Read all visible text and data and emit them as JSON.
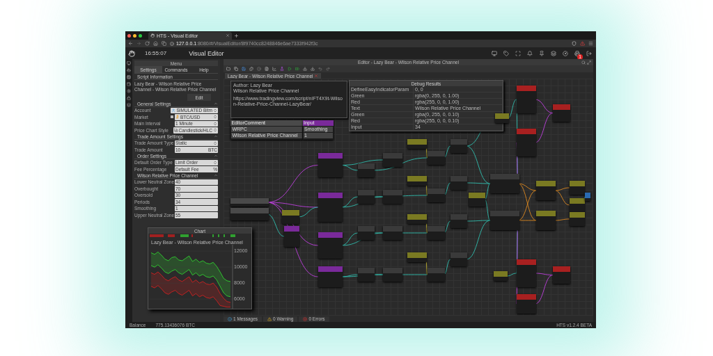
{
  "browser": {
    "tab_title": "HTS - Visual Editor",
    "url_host": "127.0.0.1",
    "url_path": ":8080/#/VisualEditor/8f9740cc8248846e6ae7333f942f3c"
  },
  "header": {
    "time": "16:55:07",
    "title": "Visual Editor",
    "badge": "1"
  },
  "menu": {
    "title": "Menu",
    "tabs": [
      {
        "label": "Settings",
        "selected": true
      },
      {
        "label": "Commands",
        "selected": false
      },
      {
        "label": "Help",
        "selected": false
      }
    ],
    "script_info": {
      "title": "Script Information",
      "text": "Lazy Bear - Wilson Relative Price Channel - Wilson Relative Price Channel",
      "button": "Edit"
    },
    "sections": [
      {
        "title": "General Settings",
        "fields": [
          {
            "label": "Account",
            "value": "SIMULATED Bitm",
            "kind": "account-select"
          },
          {
            "label": "Market",
            "value": "BTC/USD",
            "kind": "market-select"
          },
          {
            "label": "Main Interval",
            "value": "1 Minute",
            "kind": "select"
          },
          {
            "label": "Price Chart Style",
            "value": "Candlestick/HLC",
            "kind": "style-select"
          }
        ]
      },
      {
        "title": "Trade Amount Settings",
        "fields": [
          {
            "label": "Trade Amount Type",
            "value": "Static",
            "kind": "select"
          },
          {
            "label": "Trade Amount",
            "value": "10",
            "unit": "BTC",
            "kind": "unit-input"
          }
        ]
      },
      {
        "title": "Order Settings",
        "fields": [
          {
            "label": "Default Order Type",
            "value": "Limit Order",
            "kind": "select"
          },
          {
            "label": "Fee Percentage",
            "value": "Default Fee",
            "unit": "%",
            "kind": "unit-input"
          }
        ]
      },
      {
        "title": "Wilson Relative Price Channel",
        "fields": [
          {
            "label": "Lower Neutral Zone",
            "value": "40",
            "kind": "input"
          },
          {
            "label": "Overbought",
            "value": "70",
            "kind": "input"
          },
          {
            "label": "Oversold",
            "value": "30",
            "kind": "input"
          },
          {
            "label": "Periods",
            "value": "34",
            "kind": "input"
          },
          {
            "label": "Smoothing",
            "value": "1",
            "kind": "input"
          },
          {
            "label": "Upper Neutral Zone",
            "value": "55",
            "kind": "input"
          }
        ]
      }
    ]
  },
  "editor": {
    "title": "Editor - Lazy Bear - Wilson Relative Price Channel",
    "doc_tab": "Lazy Bear - Wilson Relative Price Channel",
    "comment": [
      "Author: Lazy Bear",
      "Wilson Relative Price Channel",
      "https://www.tradingview.com/script/nIFT4X9t-Wilson-Relative-Price-Channel-LazyBear/"
    ],
    "debug": {
      "title": "Debug Results",
      "rows": [
        {
          "name": "DefineEasyIndicatorParam",
          "value": "0, 0"
        },
        {
          "name": "Green",
          "value": "rgba(0, 255, 0, 1.00)"
        },
        {
          "name": "Red",
          "value": "rgba(255, 0, 0, 1.00)"
        },
        {
          "name": "Text",
          "value": "Wilson Relative Price Channel"
        },
        {
          "name": "Green",
          "value": "rgba(0, 255, 0, 0.10)"
        },
        {
          "name": "Red",
          "value": "rgba(255, 0, 0, 0.10)"
        },
        {
          "name": "Input",
          "value": "34"
        }
      ]
    },
    "nodes": [
      {
        "color": "#4a4a4a",
        "title": "EditorComment",
        "lines": [
          "WRPC",
          "Wilson Relative Price Channel"
        ]
      },
      {
        "color": "#7a2a9a",
        "title": "Input",
        "lines": [
          "Smoothing",
          "1"
        ]
      },
      {
        "color": "#4a4a4a"
      },
      {
        "color": "#4a4a4a"
      },
      {
        "color": "#7a7a22"
      },
      {
        "color": "#7a2a9a"
      },
      {
        "color": "#7a2a9a"
      },
      {
        "color": "#7a2a9a"
      },
      {
        "color": "#7a2a9a"
      },
      {
        "color": "#7a2a9a"
      },
      {
        "color": "#3a3a3a"
      },
      {
        "color": "#3a3a3a"
      },
      {
        "color": "#3a3a3a"
      },
      {
        "color": "#3a3a3a"
      },
      {
        "color": "#3a3a3a"
      },
      {
        "color": "#3a3a3a"
      },
      {
        "color": "#3a3a3a"
      },
      {
        "color": "#3a3a3a"
      },
      {
        "color": "#7a7a22"
      },
      {
        "color": "#7a7a22"
      },
      {
        "color": "#7a7a22"
      },
      {
        "color": "#7a7a22"
      },
      {
        "color": "#3a3a3a"
      },
      {
        "color": "#3a3a3a"
      },
      {
        "color": "#3a3a3a"
      },
      {
        "color": "#3a3a3a"
      },
      {
        "color": "#3a3a3a"
      },
      {
        "color": "#3a3a3a"
      },
      {
        "color": "#3a3a3a"
      },
      {
        "color": "#3a3a3a"
      },
      {
        "color": "#7a7a22"
      },
      {
        "color": "#3a3a3a"
      },
      {
        "color": "#3a3a3a"
      },
      {
        "color": "#7a7a22"
      },
      {
        "color": "#7a7a22"
      },
      {
        "color": "#a82020"
      },
      {
        "color": "#a82020"
      },
      {
        "color": "#a82020"
      },
      {
        "color": "#a82020"
      },
      {
        "color": "#7a7a22"
      },
      {
        "color": "#7a7a22"
      },
      {
        "color": "#a82020"
      },
      {
        "color": "#a82020"
      },
      {
        "color": "#7a7a22"
      },
      {
        "color": "#7a7a22"
      },
      {
        "color": "#7a7a22"
      },
      {
        "color": "#2a6ab0"
      }
    ]
  },
  "messages": [
    {
      "label": "1 Messages",
      "kind": "info"
    },
    {
      "label": "0 Warning",
      "kind": "warning"
    },
    {
      "label": "0 Errors",
      "kind": "error"
    }
  ],
  "chart": {
    "title": "Chart",
    "chart_data": {
      "type": "line",
      "title": "Lazy Bear - Wilson Relative Price Channel",
      "ylim": [
        4800,
        12800
      ],
      "grid": true,
      "yticks": [
        12000,
        10000,
        8000,
        6000
      ],
      "series": [
        {
          "color": "#30d030",
          "values": [
            11800,
            11600,
            11900,
            11500,
            11000,
            10800,
            11200,
            11300,
            10900,
            10800,
            11100,
            11400,
            10700,
            11000,
            10600,
            10800,
            10500,
            10400,
            10600,
            10100,
            9400,
            8600,
            8300,
            8200
          ]
        },
        {
          "color": "#30d030",
          "values": [
            10200,
            10000,
            10300,
            9900,
            9400,
            9200,
            9500,
            9700,
            9300,
            9100,
            9400,
            9700,
            9000,
            9300,
            8900,
            9100,
            8800,
            8700,
            8900,
            8400,
            7600,
            6800,
            6400,
            6300
          ]
        },
        {
          "color": "#d02020",
          "values": [
            9300,
            9100,
            9400,
            9000,
            8500,
            8300,
            8600,
            8800,
            8400,
            8200,
            8500,
            8800,
            8100,
            8400,
            8000,
            8200,
            7900,
            7800,
            8000,
            7500,
            6700,
            6100,
            5700,
            5600
          ]
        },
        {
          "color": "#d02020",
          "values": [
            7600,
            7400,
            7700,
            7300,
            6800,
            6600,
            6900,
            7100,
            6700,
            6500,
            6800,
            7100,
            6400,
            6700,
            6300,
            6500,
            6200,
            6100,
            6300,
            5800,
            5200,
            5100,
            5000,
            5000
          ]
        }
      ]
    }
  },
  "status": {
    "balance_label": "Balance",
    "balance": "775.13436076 BTC",
    "version": "HTS v1.2.4 BETA"
  }
}
